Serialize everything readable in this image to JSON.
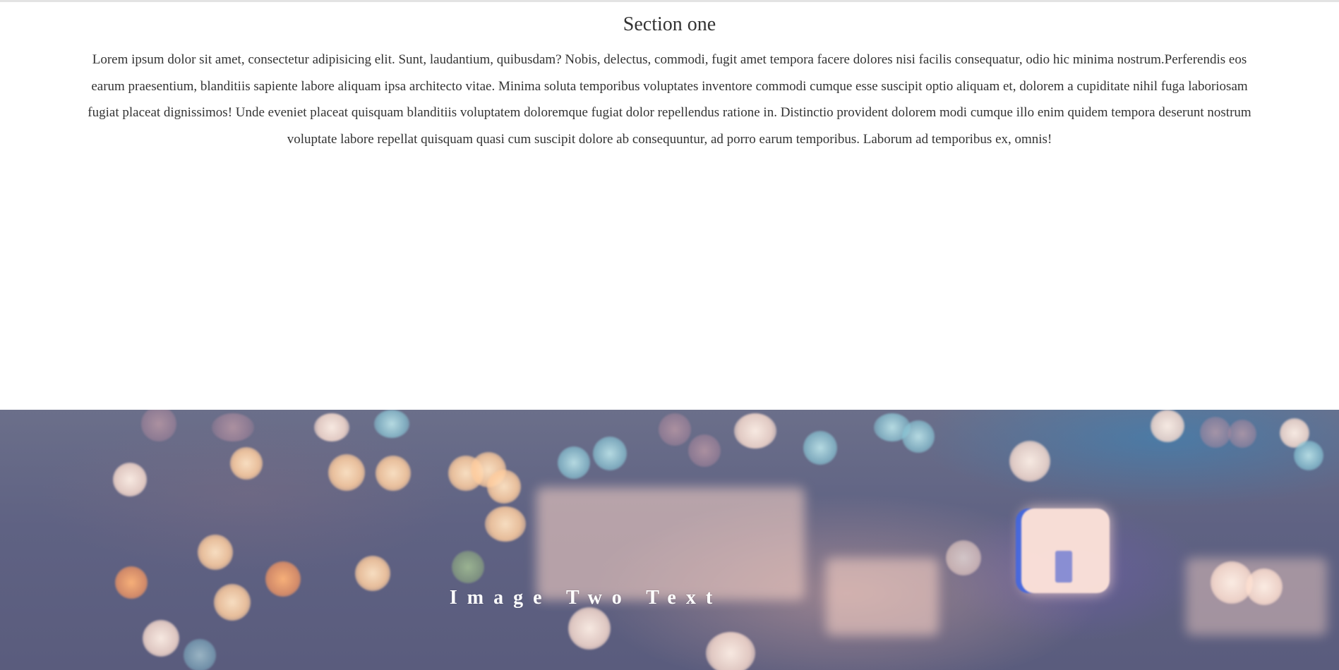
{
  "section_one": {
    "title": "Section one",
    "body": "Lorem ipsum dolor sit amet, consectetur adipisicing elit. Sunt, laudantium, quibusdam? Nobis, delectus, commodi, fugit amet tempora facere dolores nisi facilis consequatur, odio hic minima nostrum.Perferendis eos earum praesentium, blanditiis sapiente labore aliquam ipsa architecto vitae. Minima soluta temporibus voluptates inventore commodi cumque esse suscipit optio aliquam et, dolorem a cupiditate nihil fuga laboriosam fugiat placeat dignissimos! Unde eveniet placeat quisquam blanditiis voluptatem doloremque fugiat dolor repellendus ratione in. Distinctio provident dolorem modi cumque illo enim quidem tempora deserunt nostrum voluptate labore repellat quisquam quasi cum suscipit dolore ab consequuntur, ad porro earum temporibus. Laborum ad temporibus ex, omnis!"
  },
  "image_two": {
    "text": "Image Two Text"
  },
  "colors": {
    "page_background": "#ffffff",
    "body_text": "#333333",
    "overlay_text": "#ffffff",
    "image_base": "#5f6283"
  }
}
